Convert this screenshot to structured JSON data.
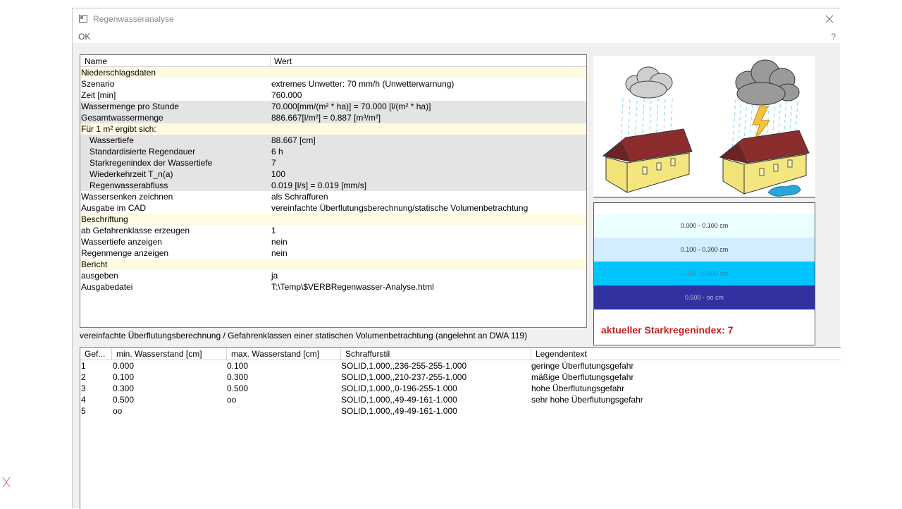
{
  "window": {
    "title": "Regenwasseranalyse"
  },
  "menu": {
    "ok": "OK",
    "help": "?"
  },
  "properties": {
    "col_name": "Name",
    "col_value": "Wert",
    "rows": [
      {
        "name": "Niederschlagsdaten",
        "value": "",
        "type": "section"
      },
      {
        "name": "Szenario",
        "value": "extremes Unwetter: 70 mm/h (Unwetterwarnung)",
        "type": "normal"
      },
      {
        "name": "Zeit [min]",
        "value": "760.000",
        "type": "normal"
      },
      {
        "name": "Wassermenge pro Stunde",
        "value": "70.000[mm/(m² * ha)] = 70.000 [l/(m² * ha)]",
        "type": "gray"
      },
      {
        "name": "Gesamtwassermenge",
        "value": "886.667[l/m²] = 0.887 [m³/m²]",
        "type": "gray"
      },
      {
        "name": "Für 1 m² ergibt sich:",
        "value": "",
        "type": "section"
      },
      {
        "name": "Wassertiefe",
        "value": "88.667 [cm]",
        "type": "gray-indent"
      },
      {
        "name": "Standardisierte Regendauer",
        "value": "6 h",
        "type": "gray-indent"
      },
      {
        "name": "Starkregenindex der Wassertiefe",
        "value": "7",
        "type": "gray-indent"
      },
      {
        "name": "Wiederkehrzeit T_n(a)",
        "value": "100",
        "type": "gray-indent"
      },
      {
        "name": "Regenwasserabfluss",
        "value": "0.019 [l/s] = 0.019 [mm/s]",
        "type": "gray-indent"
      },
      {
        "name": "Wassersenken zeichnen",
        "value": "als Schraffuren",
        "type": "normal"
      },
      {
        "name": "Ausgabe im CAD",
        "value": "vereinfachte Überflutungsberechnung/statische Volumenbetrachtung",
        "type": "normal"
      },
      {
        "name": "Beschriftung",
        "value": "",
        "type": "section"
      },
      {
        "name": "ab Gefahrenklasse erzeugen",
        "value": "1",
        "type": "normal"
      },
      {
        "name": "Wassertiefe anzeigen",
        "value": "nein",
        "type": "normal"
      },
      {
        "name": "Regenmenge anzeigen",
        "value": "nein",
        "type": "normal"
      },
      {
        "name": "Bericht",
        "value": "",
        "type": "section"
      },
      {
        "name": "ausgeben",
        "value": "ja",
        "type": "normal"
      },
      {
        "name": "Ausgabedatei",
        "value": "T:\\Temp\\$VERBRegenwasser-Analyse.html",
        "type": "normal"
      }
    ]
  },
  "legend": {
    "bands": [
      {
        "label": "0.000 - 0.100 cm",
        "color": "#ecffff",
        "text_color": "#333333"
      },
      {
        "label": "0.100 - 0.300 cm",
        "color": "#d2edff",
        "text_color": "#333333"
      },
      {
        "label": "0.300 - 0.500 cm",
        "color": "#00c4ff",
        "text_color": "#4a7fa0"
      },
      {
        "label": "0.500 - oo cm",
        "color": "#3131a1",
        "text_color": "#b8bcd8"
      }
    ],
    "index_label": "aktueller Starkregenindex: 7"
  },
  "caption": "vereinfachte Überflutungsberechnung / Gefahrenklassen einer statischen Volumenbetrachtung (angelehnt an DWA 119)",
  "table": {
    "headers": [
      "Gef...",
      "min. Wasserstand [cm]",
      "max. Wasserstand [cm]",
      "Schraffurstil",
      "Legendentext"
    ],
    "rows": [
      [
        "1",
        "0.000",
        "0.100",
        "SOLID,1.000,,236-255-255-1.000",
        "geringe Überflutungsgefahr"
      ],
      [
        "2",
        "0.100",
        "0.300",
        "SOLID,1.000,,210-237-255-1.000",
        "mäßige Überflutungsgefahr"
      ],
      [
        "3",
        "0.300",
        "0.500",
        "SOLID,1.000,,0-196-255-1.000",
        "hohe Überflutungsgefahr"
      ],
      [
        "4",
        "0.500",
        "oo",
        "SOLID,1.000,,49-49-161-1.000",
        "sehr hohe Überflutungsgefahr"
      ],
      [
        "5",
        "oo",
        "",
        "SOLID,1.000,,49-49-161-1.000",
        ""
      ]
    ]
  }
}
